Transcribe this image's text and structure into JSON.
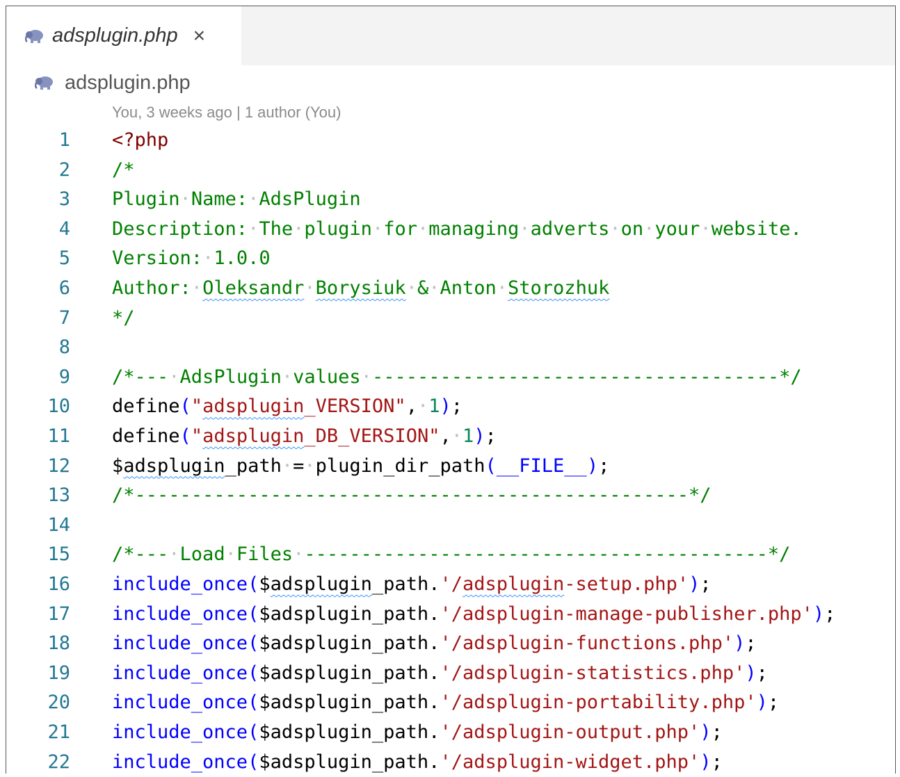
{
  "tab": {
    "title": "adsplugin.php",
    "close": "×",
    "icon": "php-elephant-icon"
  },
  "breadcrumb": {
    "label": "adsplugin.php",
    "icon": "php-elephant-icon"
  },
  "blame": "You, 3 weeks ago | 1 author (You)",
  "colors": {
    "keyword": "#800000",
    "comment": "#008000",
    "string": "#a31515",
    "number": "#098658",
    "function": "#0000ff",
    "line_number": "#237893",
    "whitespace_dot": "#bfbfbf",
    "squiggle": "#3794ff"
  },
  "lines": [
    {
      "n": "1",
      "tokens": [
        {
          "t": "<?php",
          "c": "kw"
        }
      ]
    },
    {
      "n": "2",
      "tokens": [
        {
          "t": "/*",
          "c": "comment"
        }
      ]
    },
    {
      "n": "3",
      "tokens": [
        {
          "t": "Plugin",
          "c": "comment"
        },
        {
          "t": "·",
          "c": "ws"
        },
        {
          "t": "Name:",
          "c": "comment"
        },
        {
          "t": "·",
          "c": "ws"
        },
        {
          "t": "AdsPlugin",
          "c": "comment"
        }
      ]
    },
    {
      "n": "4",
      "tokens": [
        {
          "t": "Description:",
          "c": "comment"
        },
        {
          "t": "·",
          "c": "ws"
        },
        {
          "t": "The",
          "c": "comment"
        },
        {
          "t": "·",
          "c": "ws"
        },
        {
          "t": "plugin",
          "c": "comment"
        },
        {
          "t": "·",
          "c": "ws"
        },
        {
          "t": "for",
          "c": "comment"
        },
        {
          "t": "·",
          "c": "ws"
        },
        {
          "t": "managing",
          "c": "comment"
        },
        {
          "t": "·",
          "c": "ws"
        },
        {
          "t": "adverts",
          "c": "comment"
        },
        {
          "t": "·",
          "c": "ws"
        },
        {
          "t": "on",
          "c": "comment"
        },
        {
          "t": "·",
          "c": "ws"
        },
        {
          "t": "your",
          "c": "comment"
        },
        {
          "t": "·",
          "c": "ws"
        },
        {
          "t": "website.",
          "c": "comment"
        }
      ]
    },
    {
      "n": "5",
      "tokens": [
        {
          "t": "Version:",
          "c": "comment"
        },
        {
          "t": "·",
          "c": "ws"
        },
        {
          "t": "1.0.0",
          "c": "comment"
        }
      ]
    },
    {
      "n": "6",
      "tokens": [
        {
          "t": "Author:",
          "c": "comment"
        },
        {
          "t": "·",
          "c": "ws"
        },
        {
          "t": "Oleksandr",
          "c": "comment",
          "sq": true
        },
        {
          "t": "·",
          "c": "ws"
        },
        {
          "t": "Borysiuk",
          "c": "comment",
          "sq": true
        },
        {
          "t": "·",
          "c": "ws"
        },
        {
          "t": "&",
          "c": "comment"
        },
        {
          "t": "·",
          "c": "ws"
        },
        {
          "t": "Anton",
          "c": "comment"
        },
        {
          "t": "·",
          "c": "ws"
        },
        {
          "t": "Storozhuk",
          "c": "comment",
          "sq": true
        }
      ]
    },
    {
      "n": "7",
      "tokens": [
        {
          "t": "*/",
          "c": "comment"
        }
      ]
    },
    {
      "n": "8",
      "tokens": []
    },
    {
      "n": "9",
      "tokens": [
        {
          "t": "/*---",
          "c": "comment"
        },
        {
          "t": "·",
          "c": "ws"
        },
        {
          "t": "AdsPlugin",
          "c": "comment"
        },
        {
          "t": "·",
          "c": "ws"
        },
        {
          "t": "values",
          "c": "comment"
        },
        {
          "t": "·",
          "c": "ws"
        },
        {
          "t": "------------------------------------*/",
          "c": "comment"
        }
      ]
    },
    {
      "n": "10",
      "tokens": [
        {
          "t": "define",
          "c": "plain"
        },
        {
          "t": "(",
          "c": "fn"
        },
        {
          "t": "\"",
          "c": "str"
        },
        {
          "t": "adsplugin",
          "c": "str",
          "sq": true
        },
        {
          "t": "_VERSION\"",
          "c": "str"
        },
        {
          "t": ",",
          "c": "plain"
        },
        {
          "t": "·",
          "c": "ws"
        },
        {
          "t": "1",
          "c": "num"
        },
        {
          "t": ")",
          "c": "fn"
        },
        {
          "t": ";",
          "c": "plain"
        }
      ]
    },
    {
      "n": "11",
      "tokens": [
        {
          "t": "define",
          "c": "plain"
        },
        {
          "t": "(",
          "c": "fn"
        },
        {
          "t": "\"",
          "c": "str"
        },
        {
          "t": "adsplugin",
          "c": "str",
          "sq": true
        },
        {
          "t": "_DB_VERSION\"",
          "c": "str"
        },
        {
          "t": ",",
          "c": "plain"
        },
        {
          "t": "·",
          "c": "ws"
        },
        {
          "t": "1",
          "c": "num"
        },
        {
          "t": ")",
          "c": "fn"
        },
        {
          "t": ";",
          "c": "plain"
        }
      ]
    },
    {
      "n": "12",
      "tokens": [
        {
          "t": "$",
          "c": "plain"
        },
        {
          "t": "adsplugin",
          "c": "plain",
          "sq": true
        },
        {
          "t": "_path",
          "c": "plain"
        },
        {
          "t": "·",
          "c": "ws"
        },
        {
          "t": "=",
          "c": "plain"
        },
        {
          "t": "·",
          "c": "ws"
        },
        {
          "t": "plugin_dir_path",
          "c": "plain"
        },
        {
          "t": "(",
          "c": "fn"
        },
        {
          "t": "__FILE__",
          "c": "const"
        },
        {
          "t": ")",
          "c": "fn"
        },
        {
          "t": ";",
          "c": "plain"
        }
      ]
    },
    {
      "n": "13",
      "tokens": [
        {
          "t": "/*-------------------------------------------------*/",
          "c": "comment"
        }
      ]
    },
    {
      "n": "14",
      "tokens": []
    },
    {
      "n": "15",
      "tokens": [
        {
          "t": "/*---",
          "c": "comment"
        },
        {
          "t": "·",
          "c": "ws"
        },
        {
          "t": "Load",
          "c": "comment"
        },
        {
          "t": "·",
          "c": "ws"
        },
        {
          "t": "Files",
          "c": "comment"
        },
        {
          "t": "·",
          "c": "ws"
        },
        {
          "t": "-----------------------------------------*/",
          "c": "comment"
        }
      ]
    },
    {
      "n": "16",
      "tokens": [
        {
          "t": "include_once",
          "c": "fn"
        },
        {
          "t": "(",
          "c": "fn"
        },
        {
          "t": "$",
          "c": "plain"
        },
        {
          "t": "adsplugin",
          "c": "plain",
          "sq": true
        },
        {
          "t": "_path.",
          "c": "plain"
        },
        {
          "t": "'/",
          "c": "str"
        },
        {
          "t": "adsplugin",
          "c": "str",
          "sq": true
        },
        {
          "t": "-setup.php'",
          "c": "str"
        },
        {
          "t": ")",
          "c": "fn"
        },
        {
          "t": ";",
          "c": "plain"
        }
      ]
    },
    {
      "n": "17",
      "tokens": [
        {
          "t": "include_once",
          "c": "fn"
        },
        {
          "t": "(",
          "c": "fn"
        },
        {
          "t": "$adsplugin_path.",
          "c": "plain"
        },
        {
          "t": "'/adsplugin-manage-publisher.php'",
          "c": "str"
        },
        {
          "t": ")",
          "c": "fn"
        },
        {
          "t": ";",
          "c": "plain"
        }
      ]
    },
    {
      "n": "18",
      "tokens": [
        {
          "t": "include_once",
          "c": "fn"
        },
        {
          "t": "(",
          "c": "fn"
        },
        {
          "t": "$adsplugin_path.",
          "c": "plain"
        },
        {
          "t": "'/adsplugin-functions.php'",
          "c": "str"
        },
        {
          "t": ")",
          "c": "fn"
        },
        {
          "t": ";",
          "c": "plain"
        }
      ]
    },
    {
      "n": "19",
      "tokens": [
        {
          "t": "include_once",
          "c": "fn"
        },
        {
          "t": "(",
          "c": "fn"
        },
        {
          "t": "$adsplugin_path.",
          "c": "plain"
        },
        {
          "t": "'/adsplugin-statistics.php'",
          "c": "str"
        },
        {
          "t": ")",
          "c": "fn"
        },
        {
          "t": ";",
          "c": "plain"
        }
      ]
    },
    {
      "n": "20",
      "tokens": [
        {
          "t": "include_once",
          "c": "fn"
        },
        {
          "t": "(",
          "c": "fn"
        },
        {
          "t": "$adsplugin_path.",
          "c": "plain"
        },
        {
          "t": "'/adsplugin-portability.php'",
          "c": "str"
        },
        {
          "t": ")",
          "c": "fn"
        },
        {
          "t": ";",
          "c": "plain"
        }
      ]
    },
    {
      "n": "21",
      "tokens": [
        {
          "t": "include_once",
          "c": "fn"
        },
        {
          "t": "(",
          "c": "fn"
        },
        {
          "t": "$adsplugin_path.",
          "c": "plain"
        },
        {
          "t": "'/adsplugin-output.php'",
          "c": "str"
        },
        {
          "t": ")",
          "c": "fn"
        },
        {
          "t": ";",
          "c": "plain"
        }
      ]
    },
    {
      "n": "22",
      "tokens": [
        {
          "t": "include_once",
          "c": "fn"
        },
        {
          "t": "(",
          "c": "fn"
        },
        {
          "t": "$adsplugin_path.",
          "c": "plain"
        },
        {
          "t": "'/adsplugin-widget.php'",
          "c": "str"
        },
        {
          "t": ")",
          "c": "fn"
        },
        {
          "t": ";",
          "c": "plain"
        }
      ]
    }
  ]
}
